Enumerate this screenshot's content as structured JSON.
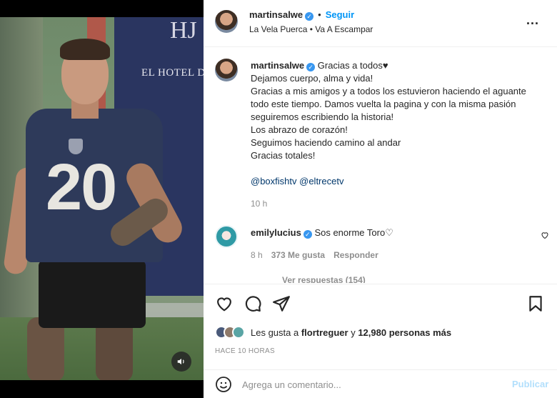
{
  "post": {
    "username": "martinsalwe",
    "follow_label": "Seguir",
    "dot": "•",
    "audio": "La Vela Puerca • Va A Escampar",
    "more_label": "..."
  },
  "media": {
    "banner_text": "EL HOTEL DE FA",
    "banner_logo": "HJ",
    "jersey_number": "20",
    "sound_icon": "speaker-icon"
  },
  "caption": {
    "username": "martinsalwe",
    "first_line": "Gracias a todos♥",
    "lines": [
      "Dejamos cuerpo, alma y vida!",
      "Gracias a mis amigos y a todos los estuvieron haciendo el aguante todo este tiempo. Damos vuelta la pagina y con la misma pasión seguiremos escribiendo la historia!",
      "Los abrazo de corazón!",
      "Seguimos haciendo camino al andar",
      "Gracias totales!"
    ],
    "mentions": [
      "@boxfishtv",
      "@eltrecetv"
    ],
    "time": "10 h"
  },
  "comment": {
    "username": "emilylucius",
    "text": "Sos enorme Toro♡",
    "time": "8 h",
    "likes": "373 Me gusta",
    "reply_label": "Responder",
    "view_replies": "Ver respuestas (154)"
  },
  "actions": {
    "likes_prefix": "Les gusta a",
    "liker": "flortreguer",
    "conjunction": "y",
    "others": "12,980 personas más",
    "date": "HACE 10 HORAS"
  },
  "input": {
    "placeholder": "Agrega un comentario...",
    "publish_label": "Publicar"
  },
  "colors": {
    "accent": "#0095f6",
    "verified": "#3897f0",
    "publish_disabled": "#b2dffc"
  }
}
